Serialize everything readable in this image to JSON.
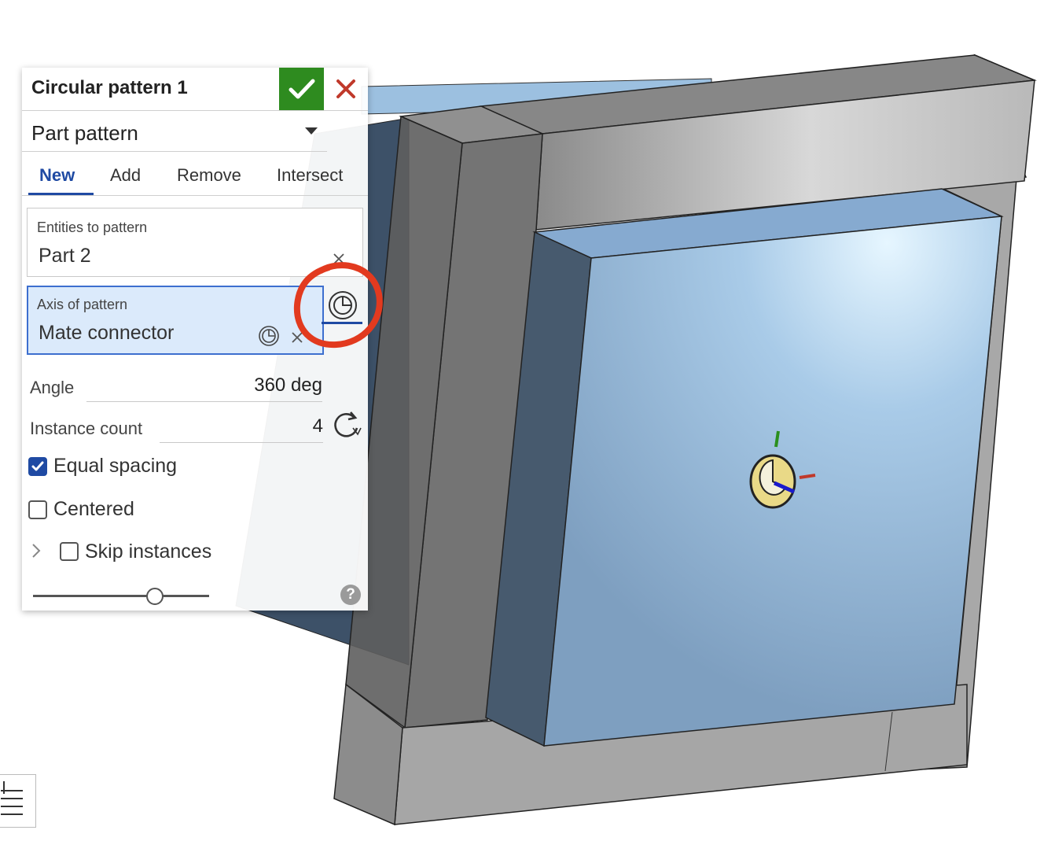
{
  "dialog": {
    "title": "Circular pattern 1",
    "pattern_type": "Part pattern",
    "tabs": [
      {
        "label": "New",
        "active": true
      },
      {
        "label": "Add",
        "active": false
      },
      {
        "label": "Remove",
        "active": false
      },
      {
        "label": "Intersect",
        "active": false
      }
    ],
    "entities": {
      "label": "Entities to pattern",
      "value": "Part 2"
    },
    "axis": {
      "label": "Axis of pattern",
      "value": "Mate connector"
    },
    "angle": {
      "label": "Angle",
      "value": "360 deg"
    },
    "instance_count": {
      "label": "Instance count",
      "value": "4"
    },
    "equal_spacing": {
      "label": "Equal spacing",
      "checked": true
    },
    "centered": {
      "label": "Centered",
      "checked": false
    },
    "skip_instances": {
      "label": "Skip instances",
      "checked": false
    },
    "slider_level": 0.69,
    "help_glyph": "?"
  },
  "icons": {
    "accept": "checkmark-icon",
    "cancel": "close-icon",
    "mate_connector": "mate-connector-icon",
    "flip": "flip-direction-icon",
    "help": "help-icon",
    "list": "list-icon"
  },
  "colors": {
    "accept_green": "#2e8b1f",
    "cancel_red": "#c0392b",
    "active_blue": "#1f4aa3",
    "selected_field": "#dbeafb",
    "annotation_red": "#e23a1f",
    "part_blue": "#8fb4d6",
    "frame_gray": "#9c9c9c"
  }
}
